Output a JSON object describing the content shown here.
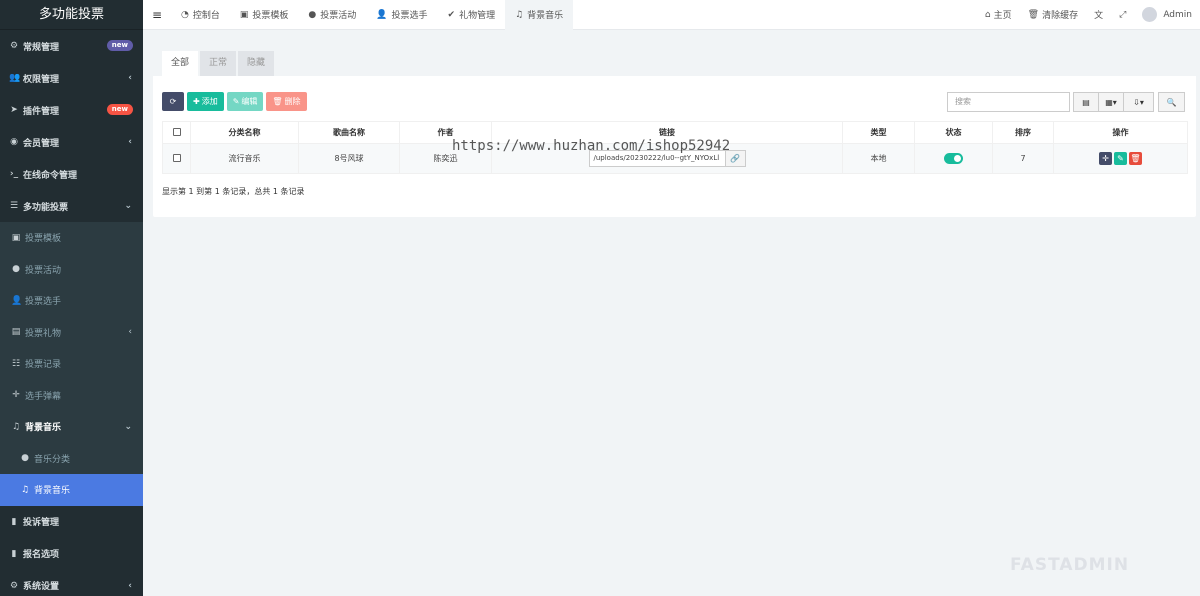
{
  "sidebar": {
    "logo": "多功能投票",
    "items": [
      {
        "label": "常规管理",
        "badge": "new"
      },
      {
        "label": "权限管理"
      },
      {
        "label": "插件管理",
        "badge": "new"
      },
      {
        "label": "会员管理"
      },
      {
        "label": "在线命令管理"
      },
      {
        "label": "多功能投票"
      }
    ],
    "sub": [
      {
        "label": "投票模板"
      },
      {
        "label": "投票活动"
      },
      {
        "label": "投票选手"
      },
      {
        "label": "投票礼物"
      },
      {
        "label": "投票记录"
      },
      {
        "label": "选手弹幕"
      },
      {
        "label": "背景音乐"
      },
      {
        "label": "音乐分类"
      },
      {
        "label": "背景音乐"
      }
    ],
    "bottom": [
      {
        "label": "投诉管理"
      },
      {
        "label": "报名选项"
      },
      {
        "label": "系统设置"
      }
    ]
  },
  "topbar": {
    "tabs": [
      "控制台",
      "投票模板",
      "投票活动",
      "投票选手",
      "礼物管理",
      "背景音乐"
    ],
    "home": "主页",
    "clear_cache": "清除缓存",
    "user": "Admin"
  },
  "panel": {
    "subtabs": [
      "全部",
      "正常",
      "隐藏"
    ],
    "toolbar": {
      "add": "添加",
      "edit": "编辑",
      "delete": "删除"
    },
    "search_placeholder": "搜索",
    "columns": [
      "分类名称",
      "歌曲名称",
      "作者",
      "链接",
      "类型",
      "状态",
      "排序",
      "操作"
    ],
    "rows": [
      {
        "category": "流行音乐",
        "song": "8号风球",
        "author": "陈奕迅",
        "link": "/uploads/20230222/lu0--gtY_NYOxLl",
        "type": "本地",
        "sort": "7"
      }
    ],
    "footer": "显示第 1 到第 1 条记录，总共 1 条记录"
  },
  "watermark": "https://www.huzhan.com/ishop52942",
  "brand_watermark": "FASTADMIN"
}
